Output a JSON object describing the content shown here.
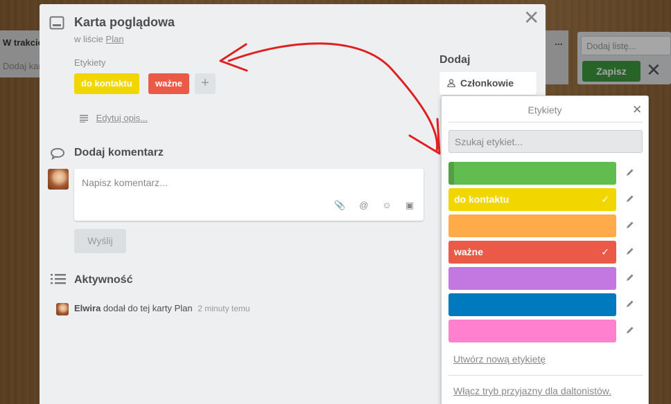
{
  "background": {
    "left_list_title": "W trakcie",
    "left_list_add": "Dodaj kartę",
    "right_list_menu": "...",
    "add_list_placeholder": "Dodaj listę...",
    "add_list_save": "Zapisz",
    "add_list_close": "✕"
  },
  "card": {
    "title": "Karta poglądowa",
    "in_list_prefix": "w liście",
    "list_name": "Plan",
    "close": "✕",
    "labels_header": "Etykiety",
    "labels": [
      {
        "text": "do kontaktu",
        "color": "#f2d600"
      },
      {
        "text": "ważne",
        "color": "#eb5a46"
      }
    ],
    "add_label": "+",
    "edit_description": "Edytuj opis...",
    "comment_section": "Dodaj komentarz",
    "comment_placeholder": "Napisz komentarz...",
    "send": "Wyślij",
    "activity_section": "Aktywność",
    "activity": {
      "user": "Elwira",
      "text": "dodał do tej karty",
      "target": "Plan",
      "time": "2 minuty temu"
    }
  },
  "sidebar": {
    "add_header": "Dodaj",
    "members": "Członkowie"
  },
  "labels_popover": {
    "title": "Etykiety",
    "close": "✕",
    "search_placeholder": "Szukaj etykiet...",
    "items": [
      {
        "text": "",
        "color": "#61bd4f",
        "selected": false
      },
      {
        "text": "do kontaktu",
        "color": "#f2d600",
        "selected": true
      },
      {
        "text": "",
        "color": "#ffab4a",
        "selected": false
      },
      {
        "text": "ważne",
        "color": "#eb5a46",
        "selected": true
      },
      {
        "text": "",
        "color": "#c377e0",
        "selected": false
      },
      {
        "text": "",
        "color": "#0079bf",
        "selected": false
      },
      {
        "text": "",
        "color": "#ff80ce",
        "selected": false
      }
    ],
    "create_label": "Utwórz nową etykietę",
    "colorblind_mode": "Włącz tryb przyjazny dla daltonistów."
  },
  "annotation_color": "#e02020"
}
